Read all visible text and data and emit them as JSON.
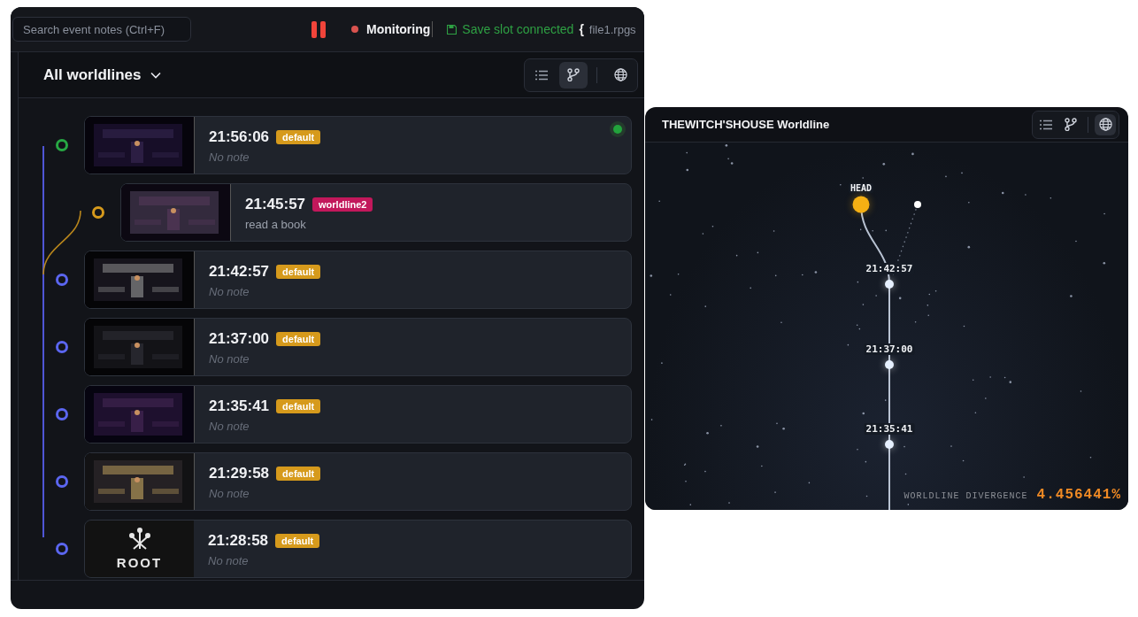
{
  "top_bar": {
    "search": {
      "placeholder": "Search event notes (Ctrl+F)"
    },
    "monitor_status": "Monitoring",
    "save_status": "Save slot connected",
    "file_brace": "{",
    "file_name": "file1.rpgs"
  },
  "header": {
    "title": "All worldlines",
    "views": [
      {
        "kind": "list",
        "selected": false
      },
      {
        "kind": "branch",
        "selected": true
      },
      {
        "kind": "globe",
        "selected": false
      }
    ]
  },
  "entries": [
    {
      "kind": "main",
      "time": "21:56:06",
      "tag": {
        "label": "default",
        "color": "#d69a1c"
      },
      "color": "#27a844",
      "current": true,
      "placeholder": "No note"
    },
    {
      "kind": "branch",
      "time": "21:45:57",
      "tag": {
        "label": "worldline2",
        "color": "#c2185b"
      },
      "color": "#d69a1c",
      "current": false,
      "note": "read a book"
    },
    {
      "kind": "main",
      "time": "21:42:57",
      "tag": {
        "label": "default",
        "color": "#d69a1c"
      },
      "color": "#5b66f0",
      "current": false,
      "placeholder": "No note"
    },
    {
      "kind": "main",
      "time": "21:37:00",
      "tag": {
        "label": "default",
        "color": "#d69a1c"
      },
      "color": "#5b66f0",
      "current": false,
      "placeholder": "No note"
    },
    {
      "kind": "main",
      "time": "21:35:41",
      "tag": {
        "label": "default",
        "color": "#d69a1c"
      },
      "color": "#5b66f0",
      "current": false,
      "placeholder": "No note"
    },
    {
      "kind": "main",
      "time": "21:29:58",
      "tag": {
        "label": "default",
        "color": "#d69a1c"
      },
      "color": "#5b66f0",
      "current": false,
      "placeholder": "No note"
    },
    {
      "kind": "root",
      "time": "21:28:58",
      "thumb_label": "ROOT",
      "tag": {
        "label": "default",
        "color": "#d69a1c"
      },
      "color": "#5b66f0",
      "current": false,
      "placeholder": "No note"
    }
  ],
  "worldline_panel": {
    "title": "THEWITCH'SHOUSE Worldline",
    "views": [
      {
        "kind": "list",
        "selected": false
      },
      {
        "kind": "branch",
        "selected": false
      },
      {
        "kind": "globe",
        "selected": true
      }
    ],
    "nodes": [
      {
        "kind": "head",
        "label": "HEAD"
      },
      {
        "kind": "branch"
      },
      {
        "kind": "commit",
        "label": "21:42:57"
      },
      {
        "kind": "commit",
        "label": "21:37:00"
      },
      {
        "kind": "commit",
        "label": "21:35:41"
      }
    ],
    "divergence_label": "WORLDLINE DIVERGENCE",
    "divergence_value": "4.456441%"
  }
}
